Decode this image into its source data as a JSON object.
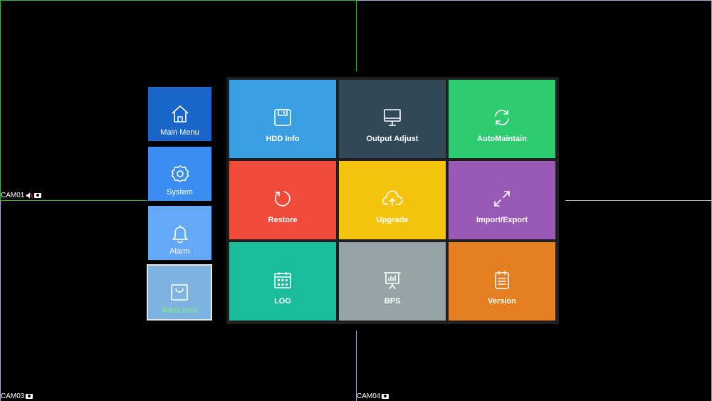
{
  "cameras": [
    {
      "id": "cam01",
      "label": "CAM01"
    },
    {
      "id": "cam03",
      "label": "CAM03"
    },
    {
      "id": "cam04",
      "label": "CAM04"
    }
  ],
  "side_menu": {
    "items": [
      {
        "label": "Main Menu",
        "icon": "home-icon",
        "color": "#1a66c8"
      },
      {
        "label": "System",
        "icon": "gear-icon",
        "color": "#3b8ef0"
      },
      {
        "label": "Alarm",
        "icon": "bell-icon",
        "color": "#63a9f7"
      },
      {
        "label": "Advanced",
        "icon": "shopping-bag-icon",
        "color": "#7fb3e0",
        "selected": true,
        "label_color": "#7bf56b"
      }
    ]
  },
  "tiles": [
    {
      "label": "HDD Info",
      "icon": "floppy-disk-icon",
      "color": "#3a9ee3"
    },
    {
      "label": "Output Adjust",
      "icon": "monitor-icon",
      "color": "#304858"
    },
    {
      "label": "AutoMaintain",
      "icon": "refresh-icon",
      "color": "#2ecc71"
    },
    {
      "label": "Restore",
      "icon": "restore-icon",
      "color": "#f04a3a"
    },
    {
      "label": "Upgrade",
      "icon": "cloud-upload-icon",
      "color": "#f6c40c"
    },
    {
      "label": "Import/Export",
      "icon": "expand-arrows-icon",
      "color": "#9b59b6"
    },
    {
      "label": "LOG",
      "icon": "calendar-icon",
      "color": "#1abc9c"
    },
    {
      "label": "BPS",
      "icon": "presentation-chart-icon",
      "color": "#95a5a6"
    },
    {
      "label": "Version",
      "icon": "document-list-icon",
      "color": "#e67e22"
    }
  ]
}
